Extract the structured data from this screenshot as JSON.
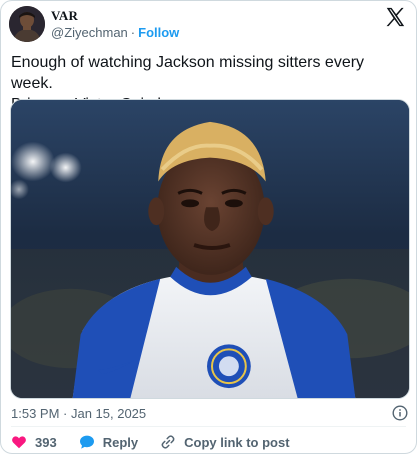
{
  "header": {
    "display_name": "VAR",
    "handle": "@Ziyechman",
    "separator": "·",
    "follow_label": "Follow"
  },
  "tweet": {
    "line1": "Enough of watching Jackson missing sitters every week.",
    "line2": "Bring on Victor Osimhen."
  },
  "meta": {
    "timestamp": "1:53 PM · Jan 15, 2025"
  },
  "actions": {
    "like_count": "393",
    "reply_label": "Reply",
    "copy_label": "Copy link to post"
  },
  "icons": {
    "brand": "x-logo-icon",
    "info": "info-icon",
    "like": "heart-icon",
    "reply": "chat-bubble-icon",
    "copy": "link-icon"
  },
  "colors": {
    "accent": "#1d9bf0",
    "like": "#f91880",
    "text": "#0f1419",
    "muted": "#536471",
    "border": "#cfd9de"
  }
}
